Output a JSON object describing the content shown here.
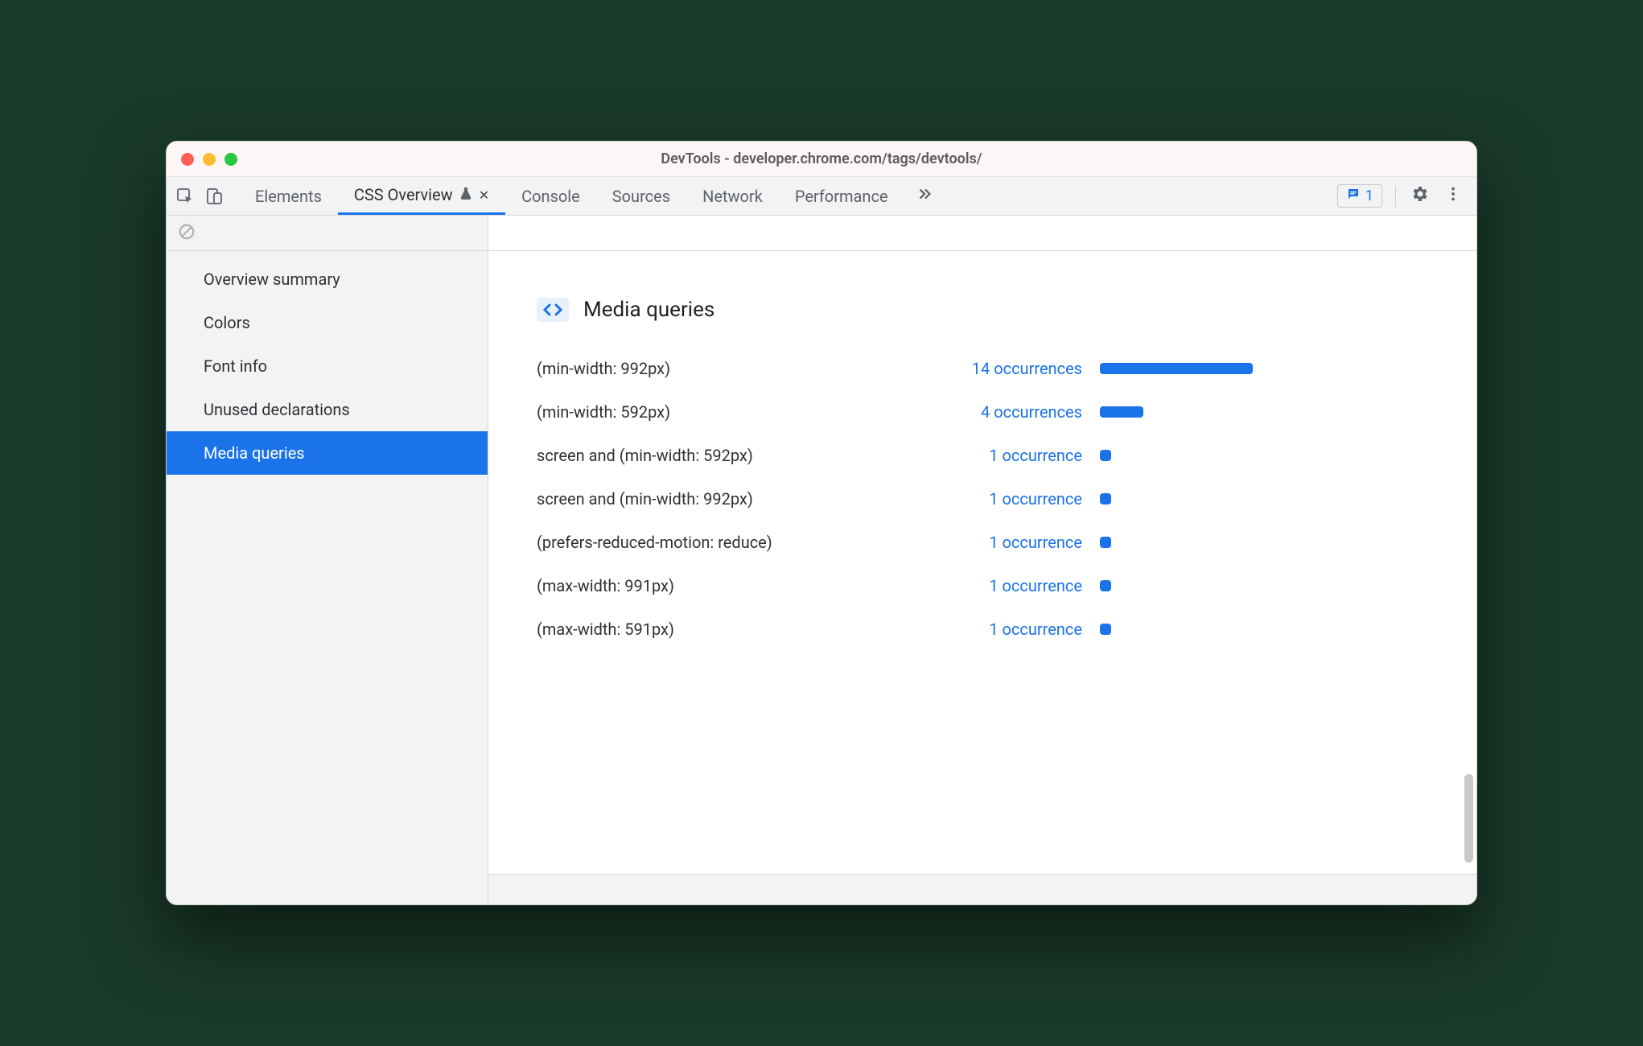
{
  "window": {
    "title": "DevTools - developer.chrome.com/tags/devtools/"
  },
  "toolbar": {
    "tabs": [
      {
        "label": "Elements"
      },
      {
        "label": "CSS Overview"
      },
      {
        "label": "Console"
      },
      {
        "label": "Sources"
      },
      {
        "label": "Network"
      },
      {
        "label": "Performance"
      }
    ],
    "active_tab_index": 1,
    "issues_count": "1"
  },
  "sidebar": {
    "items": [
      {
        "label": "Overview summary"
      },
      {
        "label": "Colors"
      },
      {
        "label": "Font info"
      },
      {
        "label": "Unused declarations"
      },
      {
        "label": "Media queries"
      }
    ],
    "selected_index": 4
  },
  "main": {
    "title": "Media queries",
    "rows": [
      {
        "query": "(min-width: 992px)",
        "occurrences": 14,
        "occ_label": "14 occurrences"
      },
      {
        "query": "(min-width: 592px)",
        "occurrences": 4,
        "occ_label": "4 occurrences"
      },
      {
        "query": "screen and (min-width: 592px)",
        "occurrences": 1,
        "occ_label": "1 occurrence"
      },
      {
        "query": "screen and (min-width: 992px)",
        "occurrences": 1,
        "occ_label": "1 occurrence"
      },
      {
        "query": "(prefers-reduced-motion: reduce)",
        "occurrences": 1,
        "occ_label": "1 occurrence"
      },
      {
        "query": "(max-width: 991px)",
        "occurrences": 1,
        "occ_label": "1 occurrence"
      },
      {
        "query": "(max-width: 591px)",
        "occurrences": 1,
        "occ_label": "1 occurrence"
      }
    ]
  },
  "chart_data": {
    "type": "bar",
    "title": "Media queries",
    "xlabel": "",
    "ylabel": "occurrences",
    "categories": [
      "(min-width: 992px)",
      "(min-width: 592px)",
      "screen and (min-width: 592px)",
      "screen and (min-width: 992px)",
      "(prefers-reduced-motion: reduce)",
      "(max-width: 991px)",
      "(max-width: 591px)"
    ],
    "values": [
      14,
      4,
      1,
      1,
      1,
      1,
      1
    ],
    "ylim": [
      0,
      14
    ]
  },
  "colors": {
    "accent": "#1a73e8"
  }
}
